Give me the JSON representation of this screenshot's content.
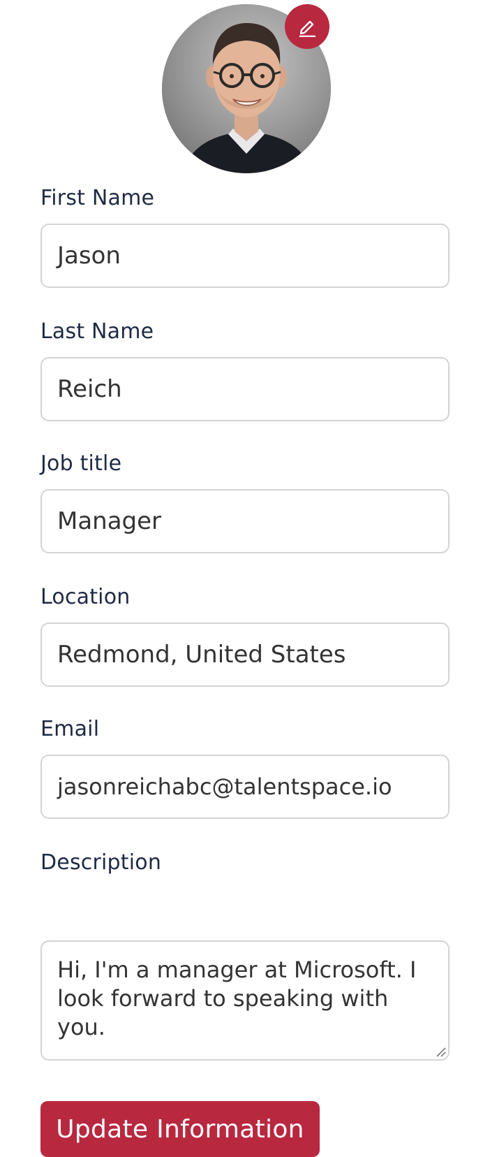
{
  "profile": {
    "avatar_icon": "profile-photo",
    "edit_icon": "pencil-icon",
    "colors": {
      "accent": "#b8283f",
      "border": "#d4d4d8",
      "label": "#1f2a44"
    }
  },
  "form": {
    "first_name": {
      "label": "First Name",
      "value": "Jason"
    },
    "last_name": {
      "label": "Last Name",
      "value": "Reich"
    },
    "job_title": {
      "label": "Job title",
      "value": "Manager"
    },
    "location": {
      "label": "Location",
      "value": "Redmond, United States"
    },
    "email": {
      "label": "Email",
      "value": "jasonreichabc@talentspace.io"
    },
    "description": {
      "label": "Description",
      "value": "Hi, I'm a manager at Microsoft. I look forward to speaking with you."
    },
    "submit_label": "Update Information"
  }
}
